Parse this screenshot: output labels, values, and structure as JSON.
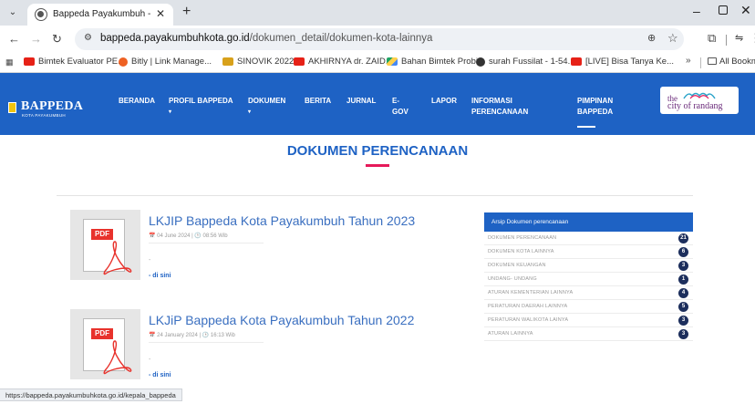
{
  "browser": {
    "tab_title": "Bappeda Payakumbuh - Badan",
    "url_host": "bappeda.payakumbuhkota.go.id",
    "url_path": "/dokumen_detail/dokumen-kota-lainnya",
    "bookmarks": [
      {
        "label": "Bimtek Evaluator PE...",
        "icon": "youtube-icon"
      },
      {
        "label": "Bitly | Link Manage...",
        "icon": "bitly-icon"
      },
      {
        "label": "SINOVIK 2022",
        "icon": "sinovik-icon"
      },
      {
        "label": "AKHIRNYA dr. ZAID...",
        "icon": "youtube-icon"
      },
      {
        "label": "Bahan Bimtek Probi...",
        "icon": "drive-icon"
      },
      {
        "label": "surah Fussilat - 1-54...",
        "icon": "globe-icon"
      },
      {
        "label": "[LIVE] Bisa Tanya Ke...",
        "icon": "youtube-icon"
      }
    ],
    "bookmarks_more": "»",
    "all_bookmarks": "All Bookmarks",
    "status_url": "https://bappeda.payakumbuhkota.go.id/kepala_bappeda"
  },
  "site": {
    "logo_title": "BAPPEDA",
    "logo_subtitle": "KOTA PAYAKUMBUH",
    "nav": [
      {
        "line1": "BERANDA",
        "line2": ""
      },
      {
        "line1": "PROFIL BAPPEDA",
        "line2": "▾"
      },
      {
        "line1": "DOKUMEN",
        "line2": "▾"
      },
      {
        "line1": "BERITA",
        "line2": ""
      },
      {
        "line1": "JURNAL",
        "line2": ""
      },
      {
        "line1": "E-",
        "line2": "GOV"
      },
      {
        "line1": "LAPOR",
        "line2": ""
      },
      {
        "line1": "INFORMASI",
        "line2": "PERENCANAAN"
      },
      {
        "line1": "PIMPINAN",
        "line2": "BAPPEDA"
      }
    ],
    "city_the": "the",
    "city_name": "city of randang"
  },
  "page": {
    "heading": "DOKUMEN PERENCANAAN",
    "documents": [
      {
        "pdf_label": "PDF",
        "title": "LKJIP Bappeda Kota Payakumbuh Tahun 2023",
        "meta": "📅 04 June 2024  |  🕒 08:56 Wib",
        "dash": "-",
        "link": "- di sini"
      },
      {
        "pdf_label": "PDF",
        "title": "LKJiP Bappeda Kota Payakumbuh Tahun 2022",
        "meta": "📅 24 January 2024  |  🕒 16:13 Wib",
        "dash": "-",
        "link": "- di sini"
      }
    ],
    "sidebar": {
      "title": "Arsip Dokumen perencanaan",
      "items": [
        {
          "label": "DOKUMEN PERENCANAAN",
          "count": "21"
        },
        {
          "label": "DOKUMEN KOTA LAINNYA",
          "count": "6"
        },
        {
          "label": "DOKUMEN KEUANGAN",
          "count": "3"
        },
        {
          "label": "UNDANG- UNDANG",
          "count": "1"
        },
        {
          "label": "ATURAN KEMENTERIAN LAINNYA",
          "count": "4"
        },
        {
          "label": "PERATURAN DAERAH LAINNYA",
          "count": "5"
        },
        {
          "label": "PERATURAN WALIKOTA LAINYA",
          "count": "3"
        },
        {
          "label": "ATURAN LAINNYA",
          "count": "3"
        }
      ]
    }
  },
  "colors": {
    "brand_blue": "#1e62c4",
    "accent_pink": "#e6195a",
    "badge_navy": "#1c2e5c",
    "pdf_red": "#e8322c"
  }
}
